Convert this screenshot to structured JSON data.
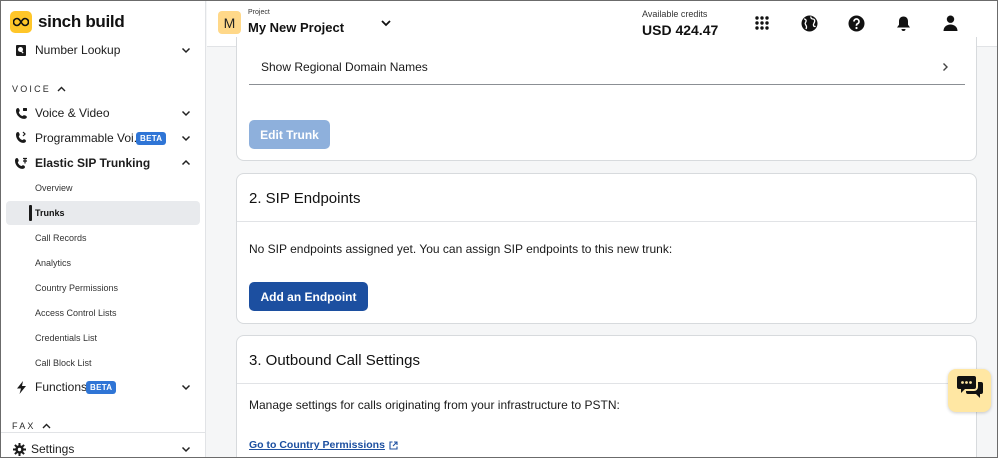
{
  "brand": {
    "name": "sinch build"
  },
  "sidebar": {
    "top_item": {
      "label": "Number Lookup"
    },
    "voice_heading": "VOICE",
    "voice_items": [
      {
        "label": "Voice & Video"
      },
      {
        "label": "Programmable Voi...",
        "badge": "BETA"
      },
      {
        "label": "Elastic SIP Trunking"
      }
    ],
    "sip_subitems": [
      {
        "label": "Overview"
      },
      {
        "label": "Trunks"
      },
      {
        "label": "Call Records"
      },
      {
        "label": "Analytics"
      },
      {
        "label": "Country Permissions"
      },
      {
        "label": "Access Control Lists"
      },
      {
        "label": "Credentials List"
      },
      {
        "label": "Call Block List"
      }
    ],
    "functions": {
      "label": "Functions",
      "badge": "BETA"
    },
    "fax_heading": "FAX",
    "settings": {
      "label": "Settings"
    }
  },
  "header": {
    "avatar_letter": "M",
    "project_label": "Project",
    "project_name": "My New Project",
    "credits_label": "Available credits",
    "credits_value": "USD 424.47"
  },
  "main": {
    "trunk_card": {
      "regional_row": "Show Regional Domain Names",
      "edit_button": "Edit Trunk"
    },
    "sip_endpoints": {
      "title": "2. SIP Endpoints",
      "message": "No SIP endpoints assigned yet. You can assign SIP endpoints to this new trunk:",
      "button": "Add an Endpoint"
    },
    "outbound": {
      "title": "3. Outbound Call Settings",
      "message": "Manage settings for calls originating from your infrastructure to PSTN:",
      "link": "Go to Country Permissions"
    }
  },
  "colors": {
    "brand_yellow": "#ffc629",
    "primary_blue": "#1c4fa0",
    "disabled_blue": "#8eb0dc",
    "badge_blue": "#2f75d6"
  },
  "icons": [
    "book-icon",
    "voice-video-icon",
    "programmable-voice-icon",
    "sip-trunking-icon",
    "bolt-icon",
    "gear-icon",
    "apps-grid-icon",
    "globe-icon",
    "help-icon",
    "bell-icon",
    "user-icon",
    "chat-icon"
  ]
}
